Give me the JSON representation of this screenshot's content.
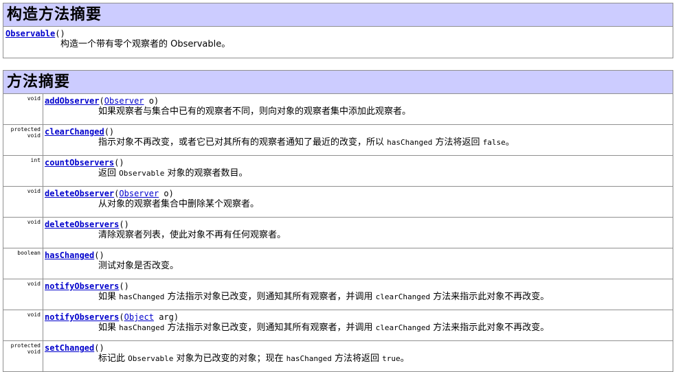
{
  "constructor_summary": {
    "title": "构造方法摘要",
    "constructor": {
      "name": "Observable",
      "params": "()",
      "description": "构造一个带有零个观察者的 Observable。"
    }
  },
  "method_summary": {
    "title": "方法摘要",
    "methods": [
      {
        "modifier_line1": "void",
        "modifier_line2": "",
        "name": "addObserver",
        "open": "(",
        "param_type": "Observer",
        "param_rest": " o)",
        "desc_parts": [
          "如果观察者与集合中已有的观察者不同，则向对象的观察者集中添加此观察者。"
        ]
      },
      {
        "modifier_line1": "protected",
        "modifier_line2": "void",
        "name": "clearChanged",
        "open": "()",
        "param_type": "",
        "param_rest": "",
        "desc_parts": [
          "指示对象不再改变，或者它已对其所有的观察者通知了最近的改变，所以 ",
          "hasChanged",
          " 方法将返回 ",
          "false",
          "。"
        ]
      },
      {
        "modifier_line1": "int",
        "modifier_line2": "",
        "name": "countObservers",
        "open": "()",
        "param_type": "",
        "param_rest": "",
        "desc_parts": [
          "返回 ",
          "Observable",
          " 对象的观察者数目。"
        ]
      },
      {
        "modifier_line1": "void",
        "modifier_line2": "",
        "name": "deleteObserver",
        "open": "(",
        "param_type": "Observer",
        "param_rest": " o)",
        "desc_parts": [
          "从对象的观察者集合中删除某个观察者。"
        ]
      },
      {
        "modifier_line1": "void",
        "modifier_line2": "",
        "name": "deleteObservers",
        "open": "()",
        "param_type": "",
        "param_rest": "",
        "desc_parts": [
          "清除观察者列表，使此对象不再有任何观察者。"
        ]
      },
      {
        "modifier_line1": "boolean",
        "modifier_line2": "",
        "name": "hasChanged",
        "open": "()",
        "param_type": "",
        "param_rest": "",
        "desc_parts": [
          "测试对象是否改变。"
        ]
      },
      {
        "modifier_line1": "void",
        "modifier_line2": "",
        "name": "notifyObservers",
        "open": "()",
        "param_type": "",
        "param_rest": "",
        "desc_parts": [
          "如果 ",
          "hasChanged",
          " 方法指示对象已改变，则通知其所有观察者，并调用 ",
          "clearChanged",
          " 方法来指示此对象不再改变。"
        ]
      },
      {
        "modifier_line1": "void",
        "modifier_line2": "",
        "name": "notifyObservers",
        "open": "(",
        "param_type": "Object",
        "param_rest": " arg)",
        "desc_parts": [
          "如果 ",
          "hasChanged",
          " 方法指示对象已改变，则通知其所有观察者，并调用 ",
          "clearChanged",
          " 方法来指示此对象不再改变。"
        ]
      },
      {
        "modifier_line1": "protected",
        "modifier_line2": "void",
        "name": "setChanged",
        "open": "()",
        "param_type": "",
        "param_rest": "",
        "desc_parts": [
          "标记此 ",
          "Observable",
          " 对象为已改变的对象；现在 ",
          "hasChanged",
          " 方法将返回 ",
          "true",
          "。"
        ]
      }
    ]
  }
}
